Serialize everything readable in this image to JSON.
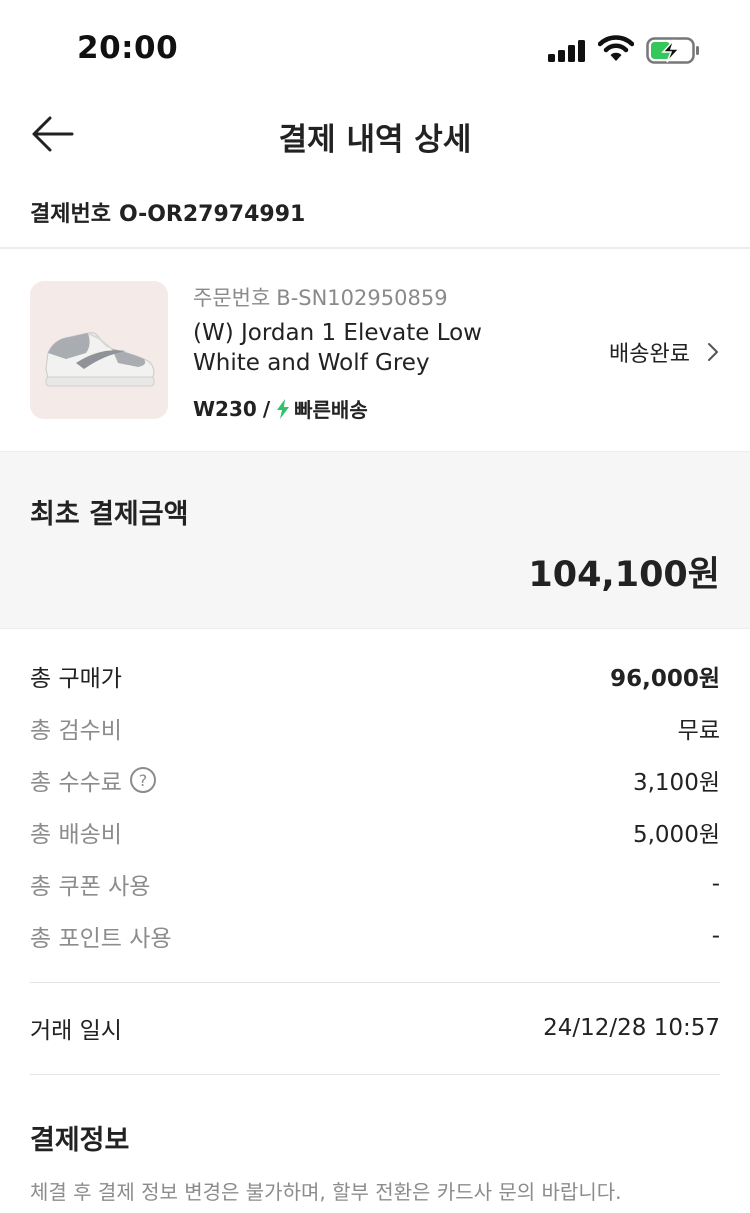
{
  "status_bar": {
    "time": "20:00"
  },
  "header": {
    "title": "결제 내역 상세",
    "back_icon": "arrow-left-icon"
  },
  "payment": {
    "label": "결제번호",
    "number": "O-OR27974991"
  },
  "product": {
    "order_label": "주문번호",
    "order_number": "B-SN102950859",
    "name_line1": "(W) Jordan 1 Elevate Low",
    "name_line2": "White and Wolf Grey",
    "size": "W230",
    "separator": "/",
    "shipping_type": "빠른배송",
    "status": "배송완료",
    "thumb_bg": "#f4eae8",
    "bolt_color": "#2ec36a"
  },
  "summary": {
    "label": "최초 결제금액",
    "amount": "104,100원"
  },
  "fees": [
    {
      "label": "총 구매가",
      "value": "96,000원"
    },
    {
      "label": "총 검수비",
      "value": "무료"
    },
    {
      "label": "총 수수료",
      "value": "3,100원",
      "help_icon": "question-circle-icon",
      "help_glyph": "?"
    },
    {
      "label": "총 배송비",
      "value": "5,000원"
    },
    {
      "label": "총 쿠폰 사용",
      "value": "-"
    },
    {
      "label": "총 포인트 사용",
      "value": "-"
    }
  ],
  "transaction": {
    "label": "거래 일시",
    "value": "24/12/28 10:57"
  },
  "payment_info": {
    "title": "결제정보",
    "notice": "체결 후 결제 정보 변경은 불가하며, 할부 전환은 카드사 문의 바랍니다."
  }
}
